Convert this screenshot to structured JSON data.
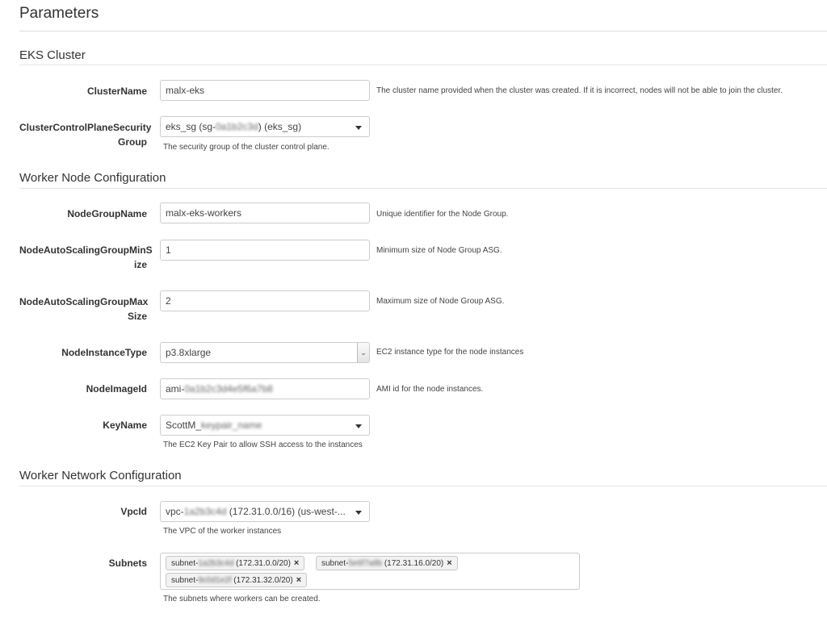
{
  "page": {
    "title": "Parameters"
  },
  "sections": {
    "eks": {
      "title": "EKS Cluster"
    },
    "worker_node": {
      "title": "Worker Node Configuration"
    },
    "worker_network": {
      "title": "Worker Network Configuration"
    }
  },
  "fields": {
    "cluster_name": {
      "label": "ClusterName",
      "value": "malx-eks",
      "description": "The cluster name provided when the cluster was created. If it is incorrect, nodes will not be able to join the cluster."
    },
    "control_plane_sg": {
      "label_line1": "ClusterControlPlaneSecurity",
      "label_line2": "Group",
      "value_prefix": "eks_sg (sg-",
      "value_redacted": "0a1b2c3d",
      "value_suffix": ") (eks_sg)",
      "help": "The security group of the cluster control plane."
    },
    "node_group_name": {
      "label": "NodeGroupName",
      "value": "malx-eks-workers",
      "description": "Unique identifier for the Node Group."
    },
    "asg_min": {
      "label_line1": "NodeAutoScalingGroupMinS",
      "label_line2": "ize",
      "value": "1",
      "description": "Minimum size of Node Group ASG."
    },
    "asg_max": {
      "label_line1": "NodeAutoScalingGroupMax",
      "label_line2": "Size",
      "value": "2",
      "description": "Maximum size of Node Group ASG."
    },
    "instance_type": {
      "label": "NodeInstanceType",
      "value": "p3.8xlarge",
      "description": "EC2 instance type for the node instances"
    },
    "image_id": {
      "label": "NodeImageId",
      "value_prefix": "ami-",
      "value_redacted": "0a1b2c3d4e5f6a7b8",
      "description": "AMI id for the node instances."
    },
    "key_name": {
      "label": "KeyName",
      "value_prefix": "ScottM_",
      "value_redacted": "keypair_name",
      "help": "The EC2 Key Pair to allow SSH access to the instances"
    },
    "vpc_id": {
      "label": "VpcId",
      "value_prefix": "vpc-",
      "value_redacted": "1a2b3c4d",
      "value_suffix": " (172.31.0.0/16) (us-west-...",
      "help": "The VPC of the worker instances"
    },
    "subnets": {
      "label": "Subnets",
      "tags": [
        {
          "prefix": "subnet-",
          "redacted": "1a2b3c4d",
          "cidr": " (172.31.0.0/20)"
        },
        {
          "prefix": "subnet-",
          "redacted": "5e6f7a8b",
          "cidr": " (172.31.16.0/20)"
        },
        {
          "prefix": "subnet-",
          "redacted": "9c0d1e2f",
          "cidr": " (172.31.32.0/20)"
        }
      ],
      "remove_glyph": "×",
      "help": "The subnets where workers can be created."
    }
  },
  "icons": {
    "dropdown_caret": "caret-down-icon",
    "native_select": "chevron-down-icon",
    "remove": "close-icon"
  },
  "colors": {
    "border": "#cccccc",
    "rule": "#dcdcdc",
    "text": "#333333",
    "tag_bg": "#f2f2f2"
  }
}
